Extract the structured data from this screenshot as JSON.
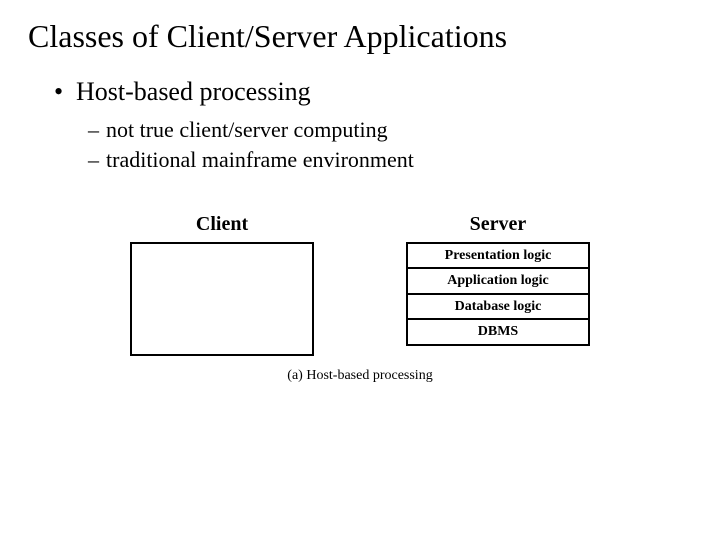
{
  "title": "Classes of Client/Server Applications",
  "bullet1": "Host-based processing",
  "sub": {
    "a": "not true client/server computing",
    "b": "traditional mainframe environment"
  },
  "diagram": {
    "client_label": "Client",
    "server_label": "Server",
    "server_layers": {
      "l0": "Presentation logic",
      "l1": "Application logic",
      "l2": "Database logic",
      "l3": "DBMS"
    },
    "caption": "(a) Host-based processing"
  }
}
